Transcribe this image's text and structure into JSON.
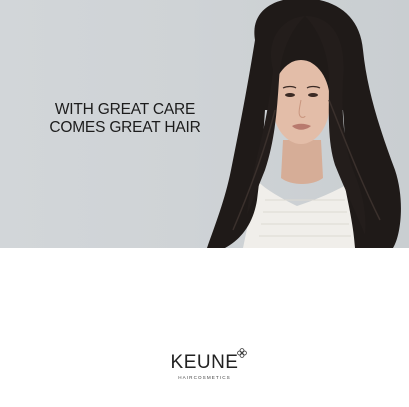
{
  "headline": {
    "line1": "WITH GREAT CARE",
    "line2": "COMES GREAT HAIR"
  },
  "brand": {
    "name": "KEUNE",
    "tagline": "HAIRCOSMETICS"
  },
  "colors": {
    "hero_background": "#cfd3d6",
    "hair": "#1f1a18",
    "skin": "#e3bda8",
    "top": "#f0eeea",
    "text": "#1c1c1c"
  },
  "image": {
    "subject": "model-portrait"
  }
}
